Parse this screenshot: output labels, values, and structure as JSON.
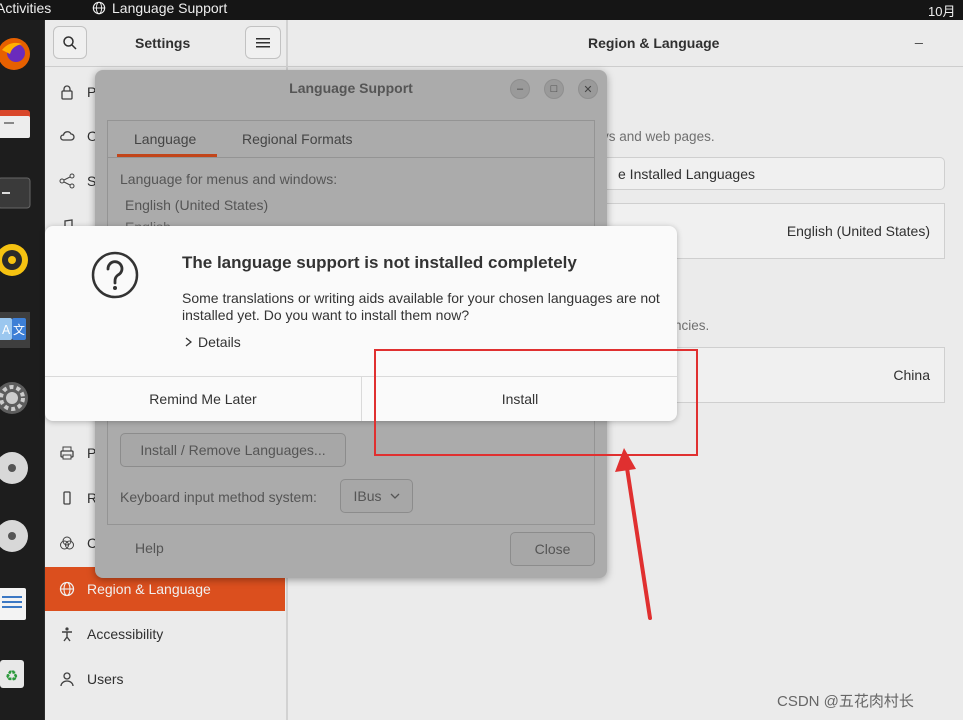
{
  "topbar": {
    "activities": "Activities",
    "app_name": "Language Support",
    "clock": "10月"
  },
  "settings": {
    "title": "Settings",
    "pane_title": "Region & Language",
    "sidebar": [
      {
        "label": "P",
        "icon": "lock-icon"
      },
      {
        "label": "O",
        "icon": "cloud-icon"
      },
      {
        "label": "S",
        "icon": "share-icon"
      },
      {
        "label": "",
        "icon": "music-icon"
      },
      {
        "label": "P",
        "icon": "printer-icon"
      },
      {
        "label": "R",
        "icon": "usb-icon"
      },
      {
        "label": "C",
        "icon": "color-icon"
      },
      {
        "label": "Region & Language",
        "icon": "globe-icon"
      },
      {
        "label": "Accessibility",
        "icon": "accessibility-icon"
      },
      {
        "label": "Users",
        "icon": "users-icon"
      }
    ],
    "main": {
      "note1": "vs and web pages.",
      "manage_button": "e Installed Languages",
      "language_value": "English (United States)",
      "note2": "ncies.",
      "formats_value": "China"
    }
  },
  "language_support": {
    "title": "Language Support",
    "tabs": [
      "Language",
      "Regional Formats"
    ],
    "menus_label": "Language for menus and windows:",
    "languages": [
      "English (United States)",
      "English"
    ],
    "install_remove": "Install / Remove Languages...",
    "keyboard_label": "Keyboard input method system:",
    "keyboard_value": "IBus",
    "help": "Help",
    "close": "Close"
  },
  "message": {
    "title": "The language support is not installed completely",
    "body": "Some translations or writing aids available for your chosen languages are not installed yet. Do you want to install them now?",
    "details": "Details",
    "remind": "Remind Me Later",
    "install": "Install"
  },
  "watermark": "CSDN @五花肉村长",
  "colors": {
    "accent": "#e95420",
    "annotation": "#e03030"
  }
}
